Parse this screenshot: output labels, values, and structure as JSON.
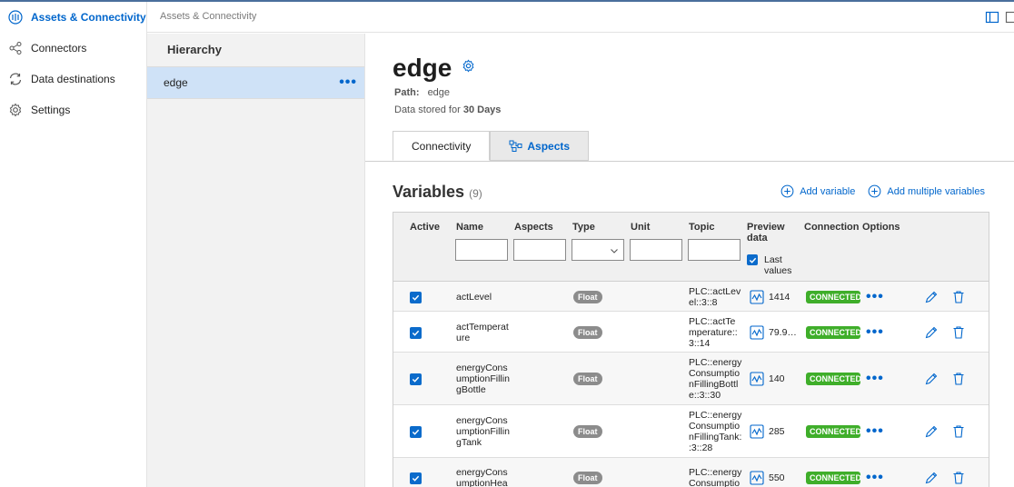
{
  "nav": {
    "items": [
      {
        "label": "Assets & Connectivity",
        "icon": "assets-connectivity-icon",
        "active": true
      },
      {
        "label": "Connectors",
        "icon": "share-nodes-icon",
        "active": false
      },
      {
        "label": "Data destinations",
        "icon": "sync-icon",
        "active": false
      },
      {
        "label": "Settings",
        "icon": "gear-icon",
        "active": false
      }
    ]
  },
  "breadcrumb": "Assets & Connectivity",
  "hierarchy": {
    "title": "Hierarchy",
    "items": [
      {
        "label": "edge",
        "selected": true
      }
    ]
  },
  "asset": {
    "name": "edge",
    "path_label": "Path:",
    "path_value": "edge",
    "stored_prefix": "Data stored for",
    "stored_value": "30 Days"
  },
  "tabs": [
    {
      "label": "Connectivity",
      "active": true
    },
    {
      "label": "Aspects",
      "active": false
    }
  ],
  "variables": {
    "title": "Variables",
    "count": "(9)",
    "add_variable": "Add variable",
    "add_multiple": "Add multiple variables",
    "columns": {
      "active": "Active",
      "name": "Name",
      "aspects": "Aspects",
      "type": "Type",
      "unit": "Unit",
      "topic": "Topic",
      "preview_line1": "Preview",
      "preview_line2": "data",
      "last_values_line1": "Last",
      "last_values_line2": "values",
      "connection": "Connection",
      "options": "Options"
    },
    "rows": [
      {
        "name": [
          "actLevel"
        ],
        "type": "Float",
        "topic": [
          "PLC::actLev",
          "el::3::8"
        ],
        "preview": "1414",
        "connection": "CONNECTED",
        "active": true
      },
      {
        "name": [
          "actTemperat",
          "ure"
        ],
        "type": "Float",
        "topic": [
          "PLC::actTe",
          "mperature::",
          "3::14"
        ],
        "preview": "79.9…",
        "connection": "CONNECTED",
        "active": true
      },
      {
        "name": [
          "energyCons",
          "umptionFillin",
          "gBottle"
        ],
        "type": "Float",
        "topic": [
          "PLC::energy",
          "Consumptio",
          "nFillingBottl",
          "e::3::30"
        ],
        "preview": "140",
        "connection": "CONNECTED",
        "active": true
      },
      {
        "name": [
          "energyCons",
          "umptionFillin",
          "gTank"
        ],
        "type": "Float",
        "topic": [
          "PLC::energy",
          "Consumptio",
          "nFillingTank:",
          ":3::28"
        ],
        "preview": "285",
        "connection": "CONNECTED",
        "active": true
      },
      {
        "name": [
          "energyCons",
          "umptionHea"
        ],
        "type": "Float",
        "topic": [
          "PLC::energy",
          "Consumptio"
        ],
        "preview": "550",
        "connection": "CONNECTED",
        "active": true
      }
    ]
  },
  "colors": {
    "accent": "#0066cc",
    "selected_bg": "#cfe2f7",
    "connected": "#3fae2a",
    "badge": "#8c8c8c"
  }
}
